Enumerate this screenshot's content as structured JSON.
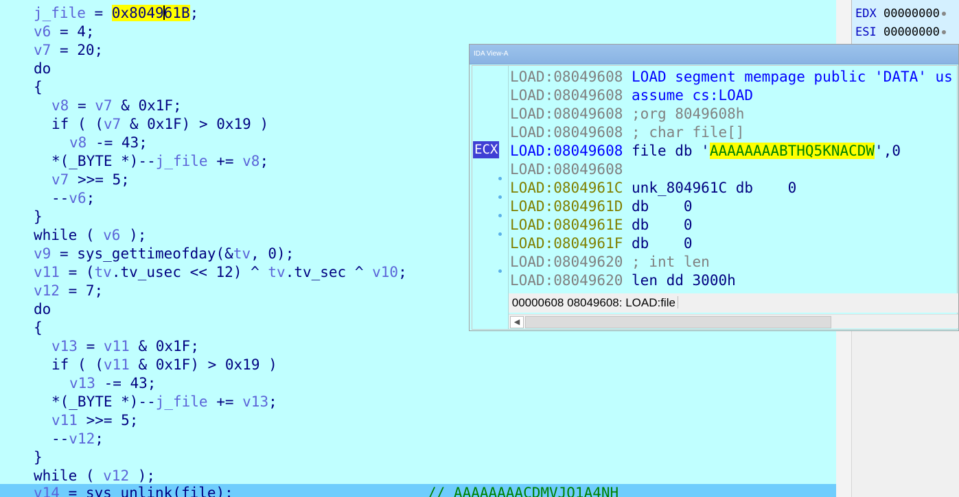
{
  "pseudocode": {
    "lines": [
      "j_file = 0x8049|61B;",
      "v6 = 4;",
      "v7 = 20;",
      "do",
      "{",
      "v8 = v7 & 0x1F;",
      "if ( (v7 & 0x1F) > 0x19 )",
      "v8 -= 43;",
      "*(_BYTE *)--j_file += v8;",
      "v7 >>= 5;",
      "--v6;",
      "}",
      "while ( v6 );",
      "v9 = sys_gettimeofday(&tv, 0);",
      "v11 = (tv.tv_usec << 12) ^ tv.tv_sec ^ v10;",
      "v12 = 7;",
      "do",
      "{",
      "v13 = v11 & 0x1F;",
      "if ( (v11 & 0x1F) > 0x19 )",
      "v13 -= 43;",
      "*(_BYTE *)--j_file += v13;",
      "v11 >>= 5;",
      "--v12;",
      "}",
      "while ( v12 );",
      "v14 = sys_unlink(file);"
    ],
    "j_file_value_left": "0x8049",
    "j_file_value_right": "61B",
    "last_line_comment": "// AAAAAAAACDMVJO1A4NH"
  },
  "registers": [
    {
      "name": "EDX",
      "value": "00000000"
    },
    {
      "name": "ESI",
      "value": "00000000"
    }
  ],
  "ida_view": {
    "title": "IDA View-A",
    "ecx_label": "ECX",
    "lines": [
      {
        "addr": "LOAD:08049608",
        "text": "LOAD segment mempage public 'DATA' us"
      },
      {
        "addr": "LOAD:08049608",
        "text": "assume cs:LOAD"
      },
      {
        "addr": "LOAD:08049608",
        "text": ";org 8049608h"
      },
      {
        "addr": "LOAD:08049608",
        "text": "; char file[]"
      },
      {
        "addr": "LOAD:08049608",
        "text_pre": "file db '",
        "string": "AAAAAAAABTHQ5KNACDW",
        "text_post": "',0"
      },
      {
        "addr": "LOAD:08049608",
        "text": ""
      },
      {
        "addr": "LOAD:0804961C",
        "text": "unk_804961C db    0"
      },
      {
        "addr": "LOAD:0804961D",
        "text": "db    0"
      },
      {
        "addr": "LOAD:0804961E",
        "text": "db    0"
      },
      {
        "addr": "LOAD:0804961F",
        "text": "db    0"
      },
      {
        "addr": "LOAD:08049620",
        "text": "; int len"
      },
      {
        "addr": "LOAD:08049620",
        "text": "len dd 3000h"
      }
    ],
    "status_offset": "00000608",
    "status_location": "08049608: LOAD:file"
  }
}
